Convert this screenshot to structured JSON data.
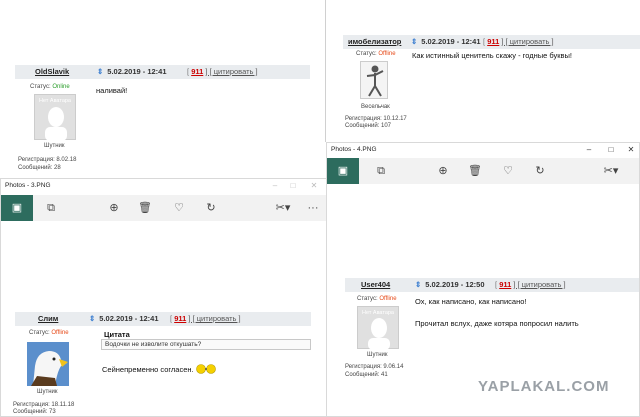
{
  "post_oldslavik": {
    "nick": "OldSlavik",
    "date": "5.02.2019 - 12:41",
    "num_open": "[",
    "num": "911",
    "quote_link": "] [ цитировать ]",
    "status_label": "Статус:",
    "status": "Online",
    "avatar_text": "Нет Аватара",
    "rank": "Шутник",
    "reg": "Регистрация: 8.02.18",
    "msgs": "Сообщений: 28",
    "body": "наливай!"
  },
  "post_imobelizator": {
    "nick": "имобелизатор",
    "date": "5.02.2019 - 12:41",
    "num_open": "[",
    "num": "911",
    "quote_link": "] [ цитировать ]",
    "status_label": "Статус:",
    "status": "Offline",
    "rank": "Весельчак",
    "reg": "Регистрация: 10.12.17",
    "msgs": "Сообщений: 107",
    "body": "Как истинный ценитель скажу - годные буквы!"
  },
  "window_3": {
    "title": "Photos - 3.PNG",
    "more": "···"
  },
  "post_slim": {
    "nick": "Слим",
    "date": "5.02.2019 - 12:41",
    "num_open": "[",
    "num": "911",
    "quote_link": "] [ цитировать ]",
    "status_label": "Статус:",
    "status": "Offline",
    "rank": "Шутник",
    "reg": "Регистрация: 18.11.18",
    "msgs": "Сообщений: 73",
    "quote_title": "Цитата",
    "quote_text": "Водочки не изволите откушать?",
    "body": "Сейнепременно согласен."
  },
  "window_4": {
    "title": "Photos - 4.PNG"
  },
  "post_user404": {
    "nick": "User404",
    "date": "5.02.2019 - 12:50",
    "num_open": "[",
    "num": "911",
    "quote_link": "] [ цитировать ]",
    "status_label": "Статус:",
    "status": "Offline",
    "avatar_text": "Нет Аватара",
    "rank": "Шутник",
    "reg": "Регистрация: 9.06.14",
    "msgs": "Сообщений: 41",
    "body1": "Ох, как написано, как написано!",
    "body2": "Прочитал вслух, даже котяра попросил налить"
  },
  "watermark": "YAPLAKAL.COM",
  "colors": {
    "accent": "#2d6c5e",
    "online": "#2a9d2a",
    "offline": "#e64a19",
    "num": "#cc0000"
  }
}
